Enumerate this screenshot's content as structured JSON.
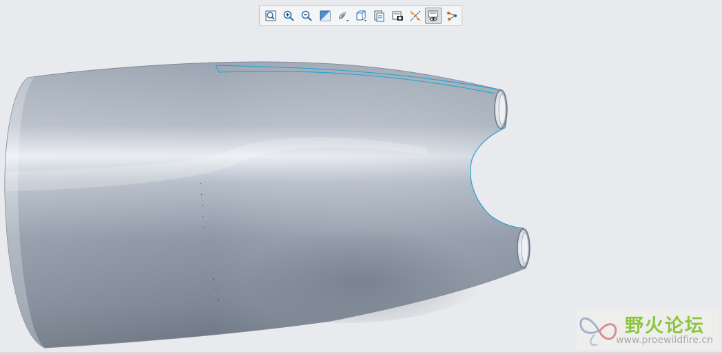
{
  "viewport": {
    "background": "#e9eaed",
    "model_color": "#a3acb8",
    "selection_edge_color": "#27a5d6"
  },
  "toolbar": {
    "buttons": [
      {
        "name": "refit-icon",
        "active": false
      },
      {
        "name": "zoom-in-icon",
        "active": false
      },
      {
        "name": "zoom-out-icon",
        "active": false
      },
      {
        "name": "repaint-icon",
        "active": false
      },
      {
        "name": "display-style-icon",
        "active": false
      },
      {
        "name": "saved-orientations-icon",
        "active": false
      },
      {
        "name": "view-manager-icon",
        "active": false
      },
      {
        "name": "perspective-view-icon",
        "active": false
      },
      {
        "name": "datum-display-icon",
        "active": false
      },
      {
        "name": "annotation-display-icon",
        "active": true
      },
      {
        "name": "spin-center-icon",
        "active": false
      }
    ]
  },
  "watermark": {
    "name": "野火论坛",
    "url": "www.proewildfire.cn",
    "name_color": "#8cc63e"
  }
}
